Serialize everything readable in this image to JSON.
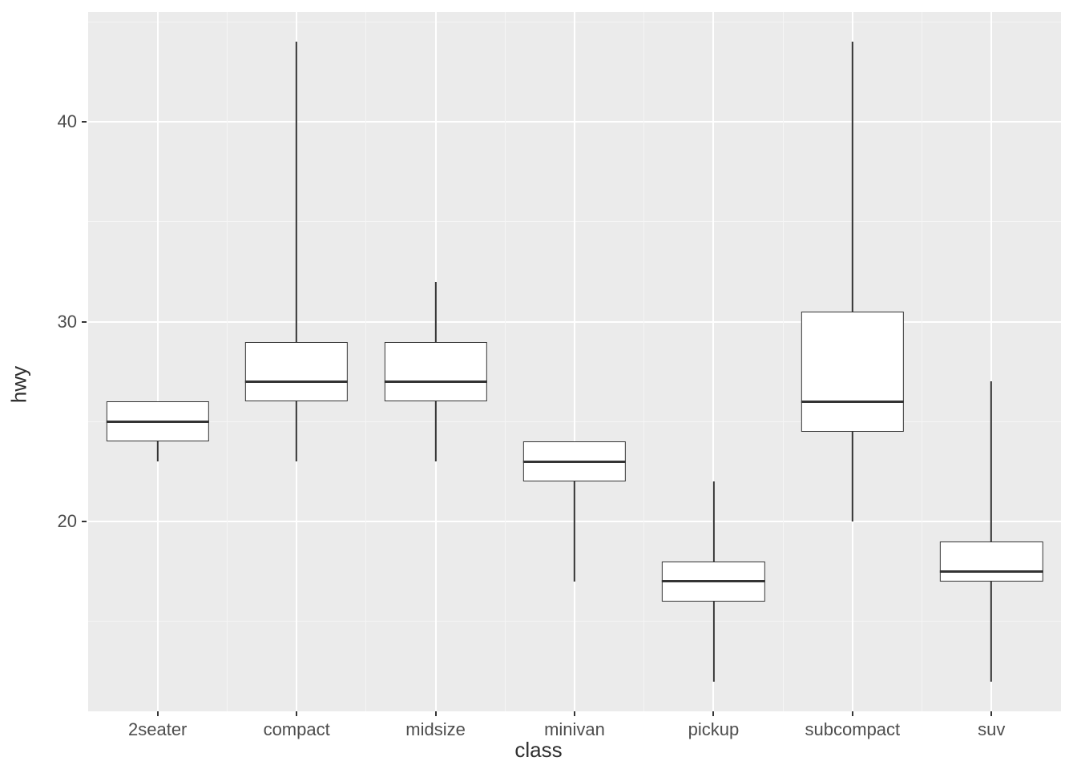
{
  "chart_data": {
    "type": "boxplot",
    "xlabel": "class",
    "ylabel": "hwy",
    "ylim": [
      10.5,
      45.5
    ],
    "y_ticks": [
      20,
      30,
      40
    ],
    "categories": [
      "2seater",
      "compact",
      "midsize",
      "minivan",
      "pickup",
      "subcompact",
      "suv"
    ],
    "series": [
      {
        "name": "2seater",
        "min": 23.0,
        "q1": 24.0,
        "median": 25.0,
        "q3": 26.0,
        "max": 26.0
      },
      {
        "name": "compact",
        "min": 23.0,
        "q1": 26.0,
        "median": 27.0,
        "q3": 29.0,
        "max": 44.0
      },
      {
        "name": "midsize",
        "min": 23.0,
        "q1": 26.0,
        "median": 27.0,
        "q3": 29.0,
        "max": 32.0
      },
      {
        "name": "minivan",
        "min": 17.0,
        "q1": 22.0,
        "median": 23.0,
        "q3": 24.0,
        "max": 24.0
      },
      {
        "name": "pickup",
        "min": 12.0,
        "q1": 16.0,
        "median": 17.0,
        "q3": 18.0,
        "max": 22.0
      },
      {
        "name": "subcompact",
        "min": 20.0,
        "q1": 24.5,
        "median": 26.0,
        "q3": 30.5,
        "max": 44.0
      },
      {
        "name": "suv",
        "min": 12.0,
        "q1": 17.0,
        "median": 17.5,
        "q3": 19.0,
        "max": 27.0
      }
    ]
  }
}
